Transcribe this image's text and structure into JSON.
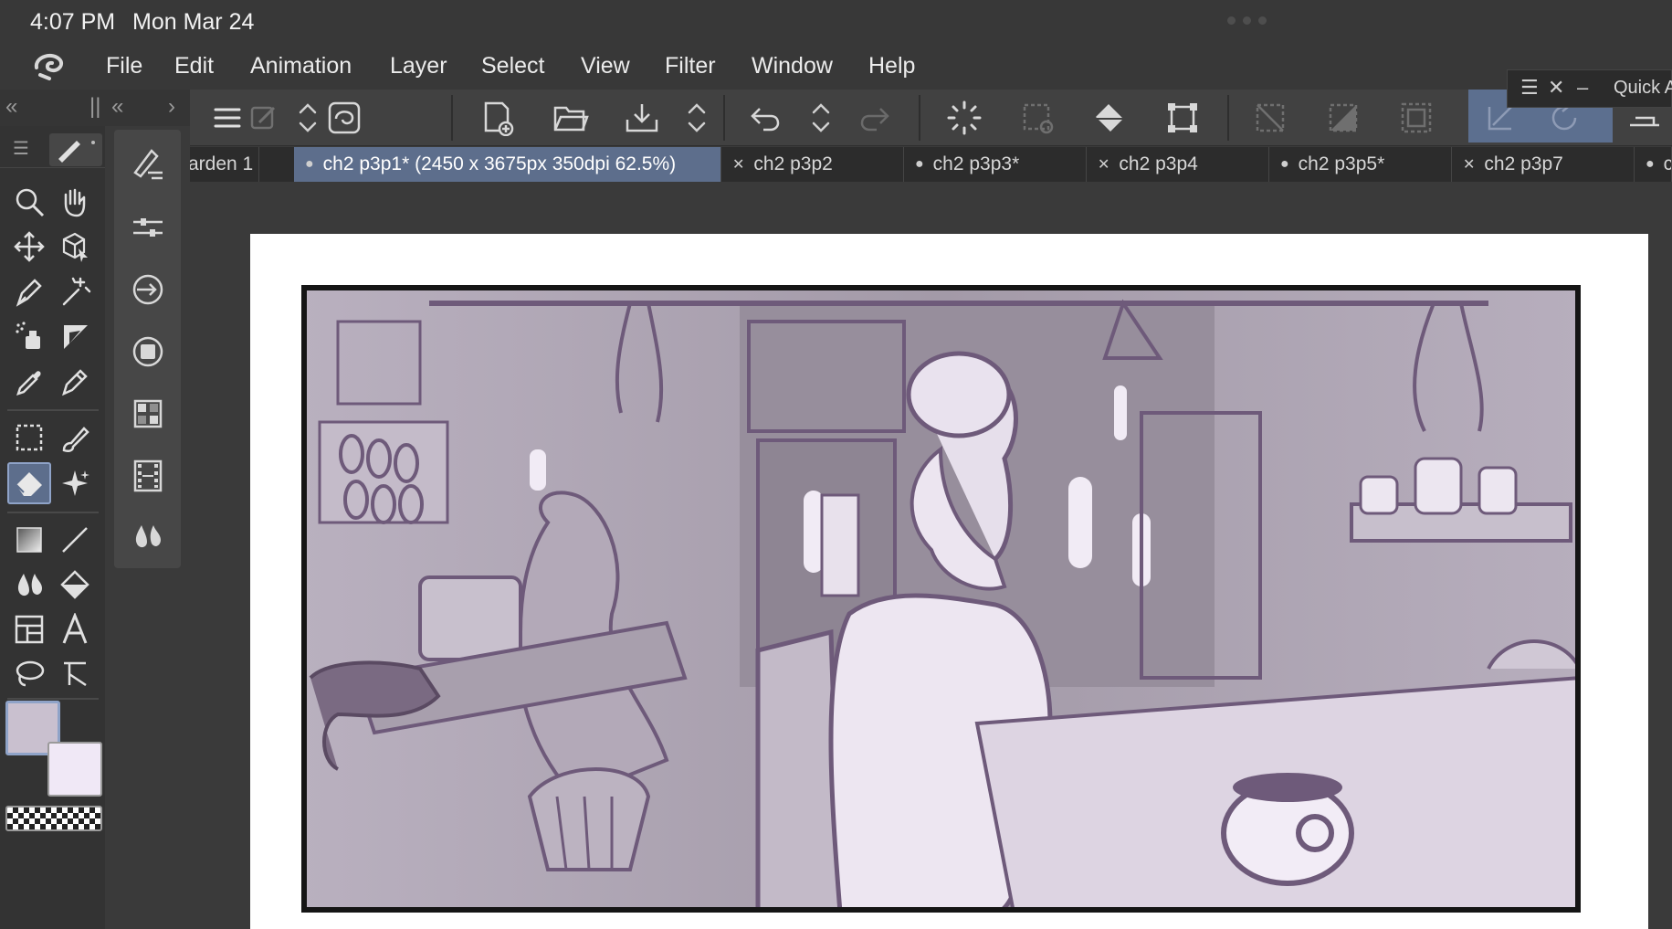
{
  "status_bar": {
    "time": "4:07 PM",
    "date": "Mon Mar 24"
  },
  "menu": {
    "items": [
      {
        "label": "File"
      },
      {
        "label": "Edit"
      },
      {
        "label": "Animation"
      },
      {
        "label": "Layer"
      },
      {
        "label": "Select"
      },
      {
        "label": "View"
      },
      {
        "label": "Filter"
      },
      {
        "label": "Window"
      },
      {
        "label": "Help"
      }
    ]
  },
  "quick_access": {
    "title": "Quick A"
  },
  "tabs": [
    {
      "label": "arden 1",
      "mark": "",
      "active": false
    },
    {
      "label": "ch2 p3p1* (2450 x 3675px 350dpi 62.5%)",
      "mark": "●",
      "active": true
    },
    {
      "label": "ch2 p3p2",
      "mark": "✕",
      "active": false
    },
    {
      "label": "ch2 p3p3*",
      "mark": "●",
      "active": false
    },
    {
      "label": "ch2 p3p4",
      "mark": "✕",
      "active": false
    },
    {
      "label": "ch2 p3p5*",
      "mark": "●",
      "active": false
    },
    {
      "label": "ch2 p3p7",
      "mark": "✕",
      "active": false
    },
    {
      "label": "c",
      "mark": "●",
      "active": false
    }
  ],
  "colors": {
    "chrome_dark": "#333333",
    "toolbar": "#414141",
    "active_tab": "#5d6e8c",
    "main_color": "#c9c0cf",
    "sub_color": "#f0e8f6",
    "sketch_line": "#6e5a7a"
  },
  "icons": {
    "tools": [
      "zoom-icon",
      "hand-icon",
      "move-icon",
      "object-icon",
      "pen-nib-icon",
      "magic-wand-icon",
      "airbrush-icon",
      "ruler-icon",
      "eyedropper-icon",
      "pen-icon",
      "selection-rect-icon",
      "brush-icon",
      "eraser-icon",
      "decoration-icon",
      "gradient-icon",
      "line-icon",
      "blend-icon",
      "fill-icon",
      "frame-icon",
      "text-icon",
      "lasso-icon",
      "correct-line-icon"
    ],
    "sub_tools": [
      "sub-tool-detail-icon",
      "tool-property-icon",
      "color-wheel-icon",
      "color-set-icon",
      "layer-property-icon",
      "color-mixing-icon",
      "filmstrip-icon",
      "blend-drop-icon"
    ]
  }
}
